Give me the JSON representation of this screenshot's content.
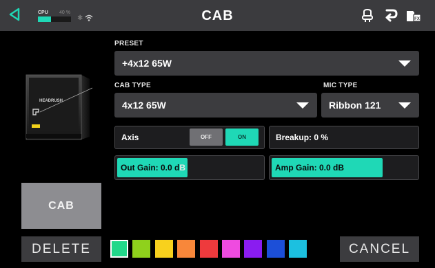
{
  "header": {
    "title": "CAB",
    "cpu_label": "CPU",
    "cpu_percent_label": "40 %",
    "cpu_percent": 40,
    "icons": [
      "back-icon",
      "bluetooth-icon",
      "wifi-icon",
      "tuner-icon",
      "redo-icon",
      "fx-icon"
    ]
  },
  "preset": {
    "label": "PRESET",
    "value": "+4x12 65W"
  },
  "cab_type": {
    "label": "CAB TYPE",
    "value": "4x12 65W"
  },
  "mic_type": {
    "label": "MIC TYPE",
    "value": "Ribbon 121"
  },
  "axis": {
    "label": "Axis",
    "off_label": "OFF",
    "on_label": "ON",
    "state": "on"
  },
  "breakup": {
    "label": "Breakup: 0 %",
    "percent": 0
  },
  "out_gain": {
    "label_main": "Out Gain: 0.0 d",
    "label_tail": "B",
    "fill_fraction": 0.48
  },
  "amp_gain": {
    "label": "Amp Gain: 0.0 dB",
    "fill_fraction": 0.76
  },
  "cab_button": {
    "label": "CAB"
  },
  "delete_button": {
    "label": "DELETE"
  },
  "cancel_button": {
    "label": "CANCEL"
  },
  "colors": {
    "accent": "#1fd8b6",
    "swatches": [
      "#22d88a",
      "#8fd11c",
      "#f8d11d",
      "#f8873a",
      "#ee3a3d",
      "#ef4be0",
      "#8a1cf0",
      "#1c4fd8",
      "#1cc0e0"
    ],
    "selected_swatch": 0
  }
}
